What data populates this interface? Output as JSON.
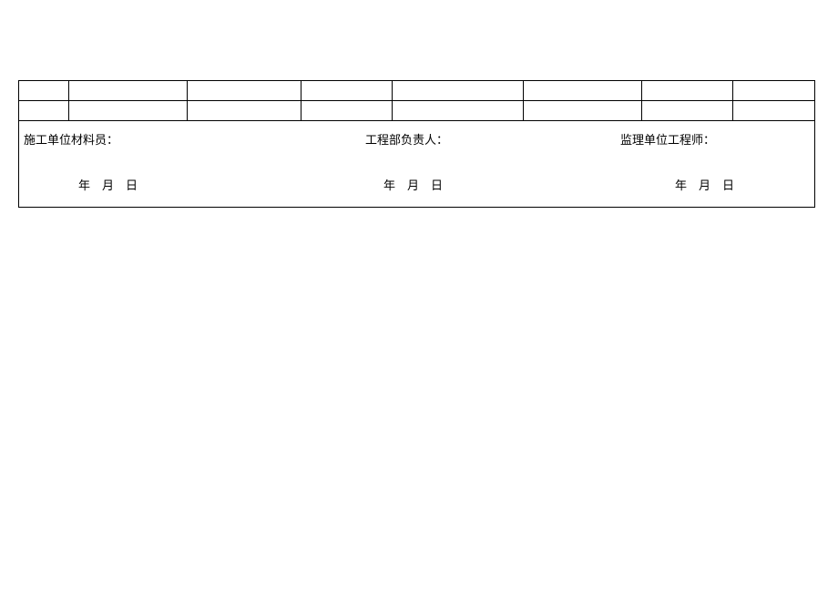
{
  "signatures": {
    "role1": "施工单位材料员：",
    "role2": "工程部负责人：",
    "role3": "监理单位工程师：",
    "date_template": "年    月    日"
  }
}
